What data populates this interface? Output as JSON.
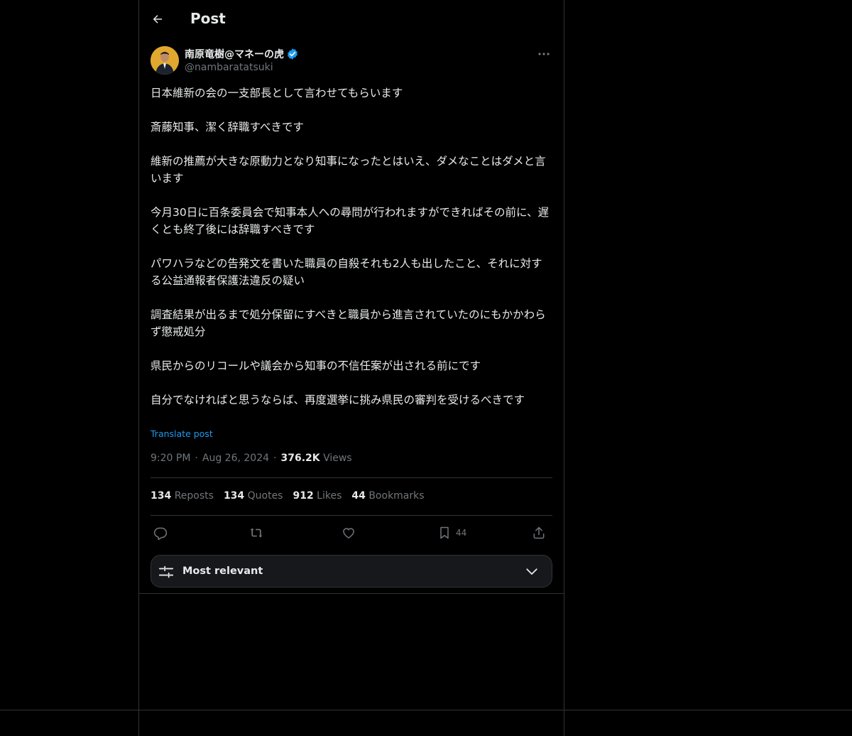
{
  "header": {
    "title": "Post"
  },
  "author": {
    "display_name": "南原竜樹@マネーの虎",
    "handle": "@nambaratatsuki",
    "verified": true
  },
  "post": {
    "paragraphs": [
      "日本維新の会の一支部長として言わせてもらいます",
      "斎藤知事、潔く辞職すべきです",
      "維新の推薦が大きな原動力となり知事になったとはいえ、ダメなことはダメと言います",
      "今月30日に百条委員会で知事本人への尋問が行われますができればその前に、遅くとも終了後には辞職すべきです",
      "パワハラなどの告発文を書いた職員の自殺それも2人も出したこと、それに対する公益通報者保護法違反の疑い",
      "調査結果が出るまで処分保留にすべきと職員から進言されていたのにもかかわらず懲戒処分",
      "県民からのリコールや議会から知事の不信任案が出される前にです",
      "自分でなければと思うならば、再度選挙に挑み県民の審判を受けるべきです"
    ],
    "translate_label": "Translate post",
    "time": "9:20 PM",
    "date": "Aug 26, 2024",
    "views_count": "376.2K",
    "views_label": "Views",
    "separator": "·"
  },
  "stats": {
    "reposts_count": "134",
    "reposts_label": "Reposts",
    "quotes_count": "134",
    "quotes_label": "Quotes",
    "likes_count": "912",
    "likes_label": "Likes",
    "bookmarks_count": "44",
    "bookmarks_label": "Bookmarks"
  },
  "actions": {
    "bookmark_count": "44"
  },
  "sort": {
    "label": "Most relevant"
  },
  "icons": {
    "back": "arrow-left-icon",
    "verified": "verified-badge-icon",
    "more": "more-horizontal-icon",
    "reply": "reply-icon",
    "repost": "repost-icon",
    "like": "heart-icon",
    "bookmark": "bookmark-icon",
    "share": "share-icon",
    "sort": "sliders-icon",
    "chevron": "chevron-down-icon"
  },
  "colors": {
    "accent": "#1d9bf0",
    "text": "#e7e9ea",
    "muted": "#71767b",
    "background": "#000000",
    "border": "#2f3336"
  }
}
